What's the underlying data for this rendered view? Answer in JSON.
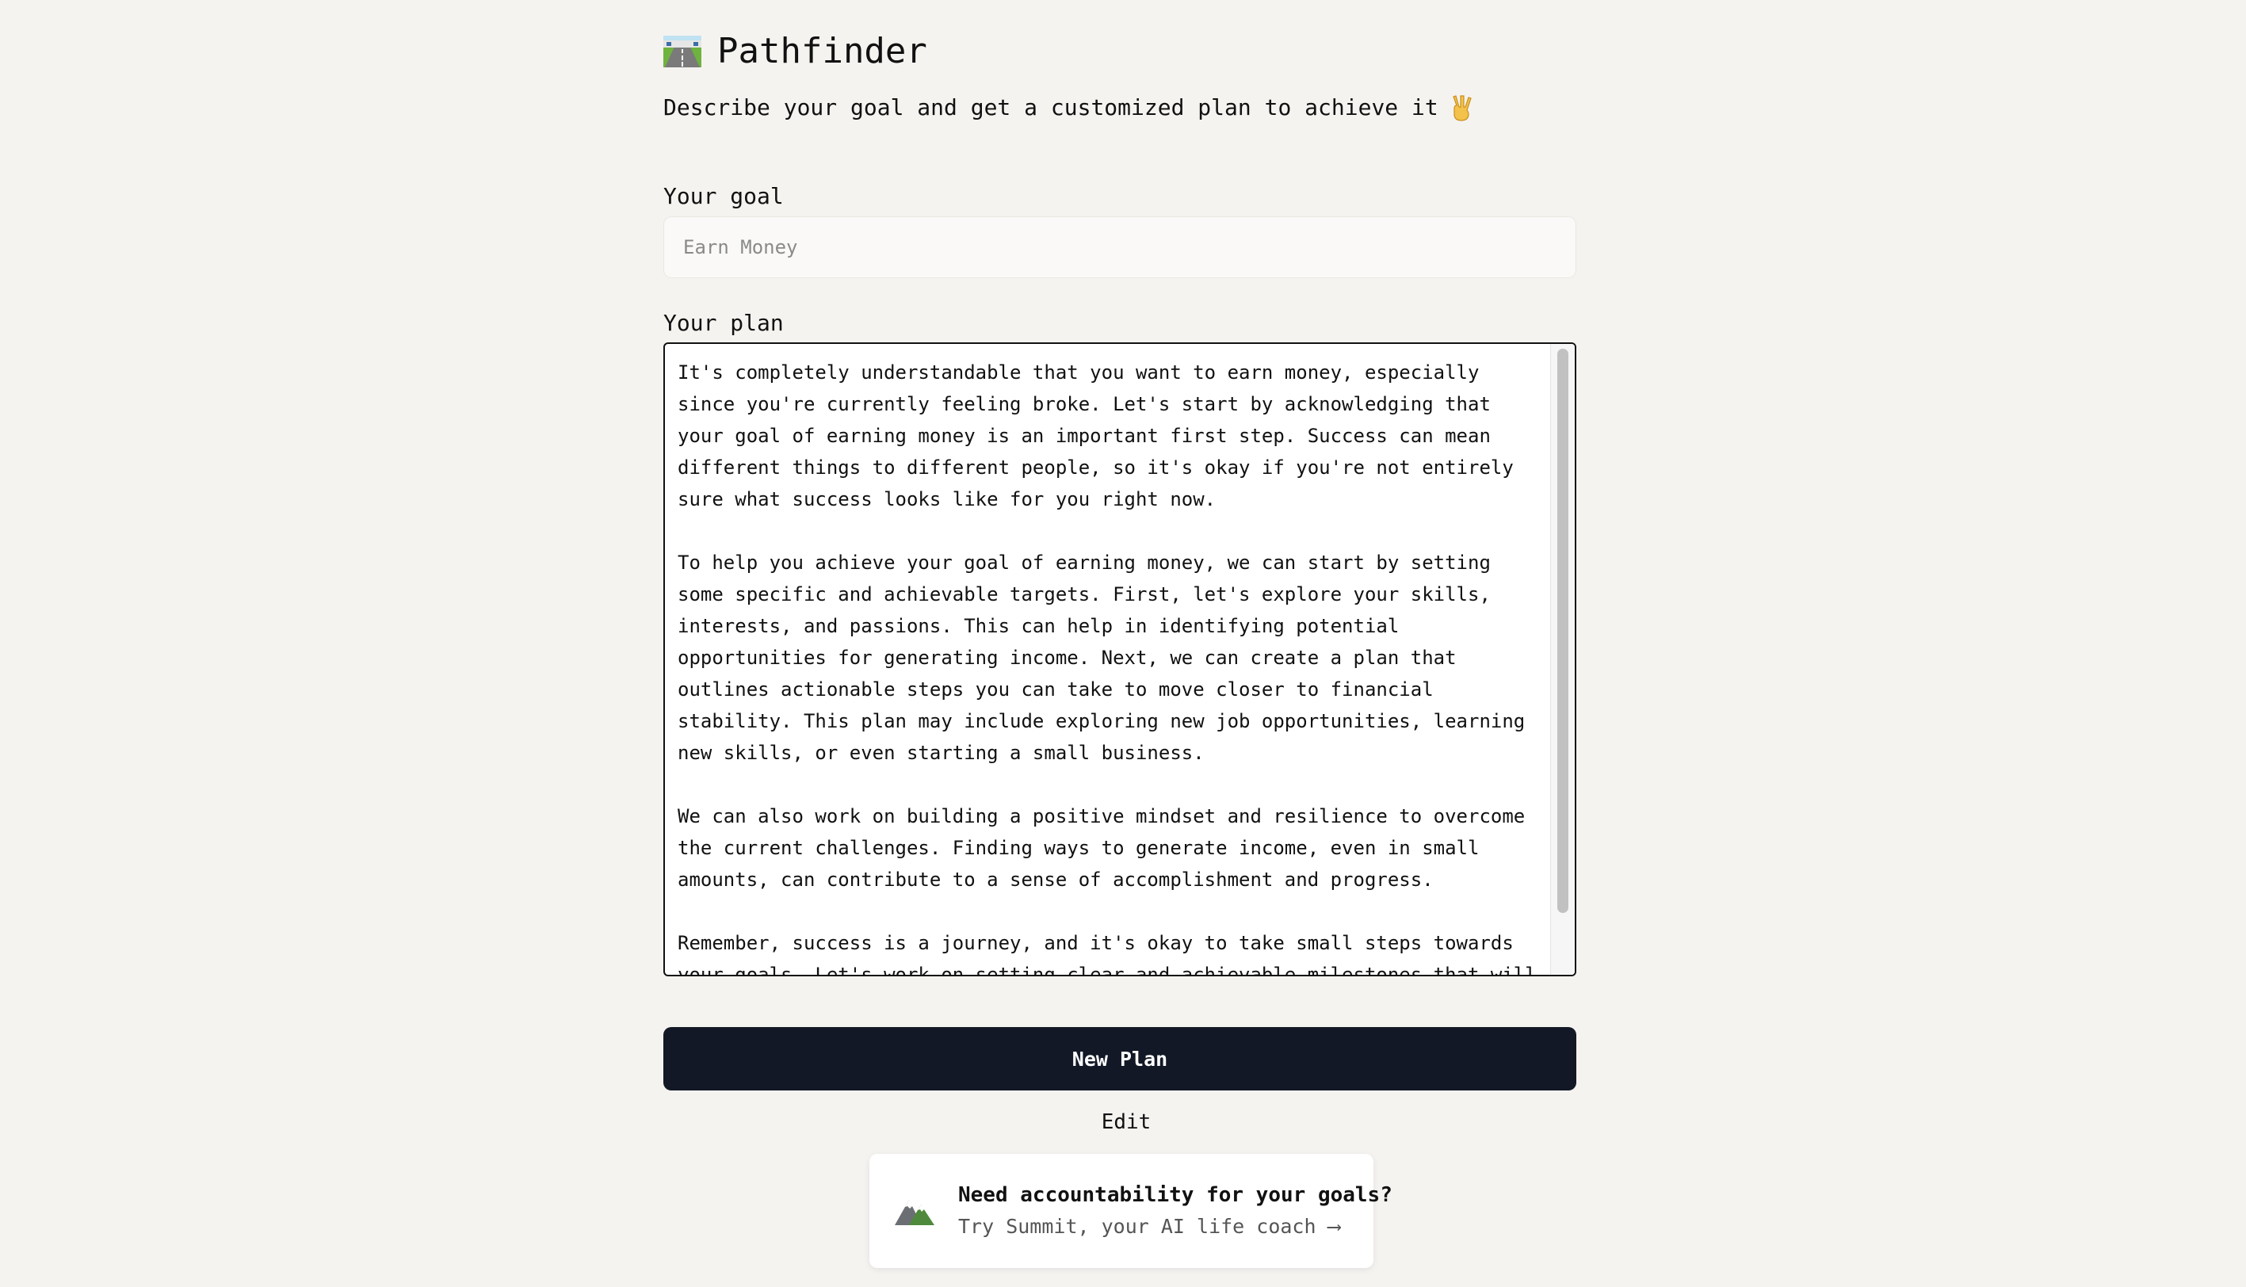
{
  "app": {
    "title": "Pathfinder",
    "logo_icon": "road-icon",
    "subtitle": "Describe your goal and get a customized plan to achieve it",
    "subtitle_icon": "victory-hand-icon"
  },
  "goal": {
    "label": "Your goal",
    "placeholder": "Earn Money",
    "value": ""
  },
  "plan": {
    "label": "Your plan",
    "paragraphs": [
      "It's completely understandable that you want to earn money, especially since you're currently feeling broke. Let's start by acknowledging that your goal of earning money is an important first step. Success can mean different things to different people, so it's okay if you're not entirely sure what success looks like for you right now.",
      "To help you achieve your goal of earning money, we can start by setting some specific and achievable targets. First, let's explore your skills, interests, and passions. This can help in identifying potential opportunities for generating income. Next, we can create a plan that outlines actionable steps you can take to move closer to financial stability. This plan may include exploring new job opportunities, learning new skills, or even starting a small business.",
      "We can also work on building a positive mindset and resilience to overcome the current challenges. Finding ways to generate income, even in small amounts, can contribute to a sense of accomplishment and progress.",
      "Remember, success is a journey, and it's okay to take small steps towards your goals. Let's work on setting clear and achievable milestones that will"
    ]
  },
  "actions": {
    "new_plan": "New Plan",
    "edit": "Edit"
  },
  "promo": {
    "icon": "mountain-icon",
    "title": "Need accountability for your goals?",
    "subtitle": "Try Summit, your AI life coach ⟶"
  },
  "colors": {
    "background": "#f5f3f0",
    "button": "#121826",
    "text": "#111111"
  }
}
